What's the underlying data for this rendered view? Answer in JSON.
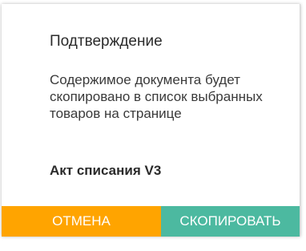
{
  "dialog": {
    "title": "Подтверждение",
    "message": "Содержимое документа будет скопировано в список выбранных товаров на странице",
    "document_name": "Акт списания V3",
    "buttons": {
      "cancel_label": "ОТМЕНА",
      "copy_label": "СКОПИРОВАТЬ"
    }
  },
  "colors": {
    "cancel_bg": "#ffa400",
    "copy_bg": "#4cb9a0"
  }
}
